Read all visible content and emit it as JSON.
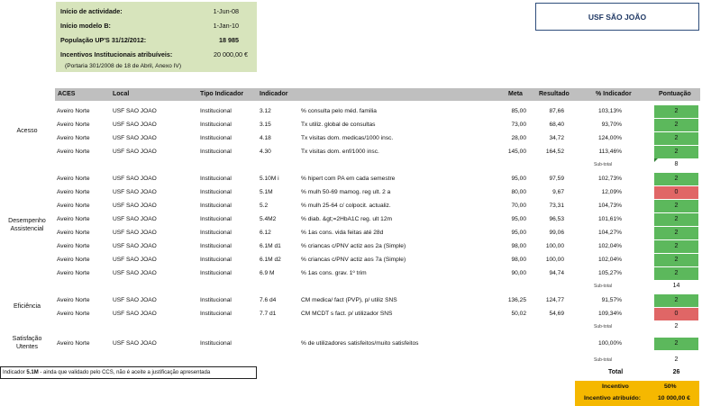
{
  "info": {
    "rows": [
      {
        "label": "Início de actividade:",
        "value": "1-Jun-08"
      },
      {
        "label": "Início modelo B:",
        "value": "1-Jan-10"
      },
      {
        "label": "População UP'S 31/12/2012:",
        "value": "18 985"
      },
      {
        "label": "Incentivos Institucionais atribuíveis:",
        "value": "20 000,00 €"
      }
    ],
    "note": "(Portaria 301/2008 de 18 de Abril, Anexo IV)"
  },
  "title": "USF SÃO JOÃO",
  "headers": {
    "aces": "ACES",
    "local": "Local",
    "tipo": "Tipo Indicador",
    "indicador": "Indicador",
    "meta": "Meta",
    "resultado": "Resultado",
    "pct": "% Indicador",
    "pontuacao": "Pontuação"
  },
  "groups": {
    "acesso": "Acesso",
    "desempenho": "Desempenho Assistencial",
    "eficiencia": "Eficiência",
    "satisfacao": "Satisfação Utentes"
  },
  "rows": [
    {
      "aces": "Aveiro Norte",
      "local": "USF SAO JOAO",
      "tipo": "Institucional",
      "code": "3.12",
      "desc": "% consulta pelo méd. familia",
      "meta": "85,00",
      "resultado": "87,66",
      "pct": "103,13%",
      "score": "2"
    },
    {
      "aces": "Aveiro Norte",
      "local": "USF SAO JOAO",
      "tipo": "Institucional",
      "code": "3.15",
      "desc": "Tx utiliz. global de consultas",
      "meta": "73,00",
      "resultado": "68,40",
      "pct": "93,70%",
      "score": "2"
    },
    {
      "aces": "Aveiro Norte",
      "local": "USF SAO JOAO",
      "tipo": "Institucional",
      "code": "4.18",
      "desc": "Tx visitas dom. medicas/1000 insc.",
      "meta": "28,00",
      "resultado": "34,72",
      "pct": "124,00%",
      "score": "2"
    },
    {
      "aces": "Aveiro Norte",
      "local": "USF SAO JOAO",
      "tipo": "Institucional",
      "code": "4.30",
      "desc": "Tx visitas dom. enf/1000 insc.",
      "meta": "145,00",
      "resultado": "164,52",
      "pct": "113,46%",
      "score": "2"
    },
    {
      "aces": "Aveiro Norte",
      "local": "USF SAO JOAO",
      "tipo": "Institucional",
      "code": "5.10M i",
      "desc": "% hipert com PA em cada semestre",
      "meta": "95,00",
      "resultado": "97,59",
      "pct": "102,73%",
      "score": "2"
    },
    {
      "aces": "Aveiro Norte",
      "local": "USF SAO JOAO",
      "tipo": "Institucional",
      "code": "5.1M",
      "desc": "% mulh 50-69 mamog. reg ult. 2 a",
      "meta": "80,00",
      "resultado": "9,67",
      "pct": "12,09%",
      "score": "0"
    },
    {
      "aces": "Aveiro Norte",
      "local": "USF SAO JOAO",
      "tipo": "Institucional",
      "code": "5.2",
      "desc": "% mulh 25-64 c/ colpocit. actualiz.",
      "meta": "70,00",
      "resultado": "73,31",
      "pct": "104,73%",
      "score": "2"
    },
    {
      "aces": "Aveiro Norte",
      "local": "USF SAO JOAO",
      "tipo": "Institucional",
      "code": "5.4M2",
      "desc": "% diab. &gt;=2HbA1C reg. ult 12m",
      "meta": "95,00",
      "resultado": "96,53",
      "pct": "101,61%",
      "score": "2"
    },
    {
      "aces": "Aveiro Norte",
      "local": "USF SAO JOAO",
      "tipo": "Institucional",
      "code": "6.12",
      "desc": "% 1as cons. vida feitas até 28d",
      "meta": "95,00",
      "resultado": "99,06",
      "pct": "104,27%",
      "score": "2"
    },
    {
      "aces": "Aveiro Norte",
      "local": "USF SAO JOAO",
      "tipo": "Institucional",
      "code": "6.1M d1",
      "desc": "% criancas c/PNV actiz aos 2a (Simple)",
      "meta": "98,00",
      "resultado": "100,00",
      "pct": "102,04%",
      "score": "2"
    },
    {
      "aces": "Aveiro Norte",
      "local": "USF SAO JOAO",
      "tipo": "Institucional",
      "code": "6.1M d2",
      "desc": "% criancas c/PNV actiz aos 7a (Simple)",
      "meta": "98,00",
      "resultado": "100,00",
      "pct": "102,04%",
      "score": "2"
    },
    {
      "aces": "Aveiro Norte",
      "local": "USF SAO JOAO",
      "tipo": "Institucional",
      "code": "6.9 M",
      "desc": "% 1as cons. grav. 1º trim",
      "meta": "90,00",
      "resultado": "94,74",
      "pct": "105,27%",
      "score": "2"
    },
    {
      "aces": "Aveiro Norte",
      "local": "USF SAO JOAO",
      "tipo": "Institucional",
      "code": "7.6 d4",
      "desc": "CM medica/ fact (PVP), p/ utiliz SNS",
      "meta": "136,25",
      "resultado": "124,77",
      "pct": "91,57%",
      "score": "2"
    },
    {
      "aces": "Aveiro Norte",
      "local": "USF SAO JOAO",
      "tipo": "Institucional",
      "code": "7.7 d1",
      "desc": "CM MCDT s fact. p/ utilizador SNS",
      "meta": "50,02",
      "resultado": "54,69",
      "pct": "109,34%",
      "score": "0"
    },
    {
      "aces": "Aveiro Norte",
      "local": "USF SAO JOAO",
      "tipo": "Institucional",
      "code": "",
      "desc": "% de utilizadores satisfeitos/muito satisfeitos",
      "meta": "",
      "resultado": "",
      "pct": "100,00%",
      "score": "2"
    }
  ],
  "subtotals": {
    "label": "Sub-total",
    "acesso": "8",
    "desempenho": "14",
    "eficiencia": "2",
    "satisfacao": "2"
  },
  "footnote": {
    "prefix": "Indicador ",
    "code": "5.1M",
    "text": " - ainda que validado pelo CCS, não é aceite a justificação apresentada"
  },
  "total": {
    "label": "Total",
    "value": "26"
  },
  "incentivo": {
    "label": "Incentivo",
    "value": "50%",
    "atribuido_label": "Incentivo atribuído:",
    "atribuido_value": "10 000,00 €"
  },
  "colors": {
    "green": "#5cb85c",
    "red": "#e06666",
    "info_bg": "#d7e4bc",
    "incentive_bg": "#f5b800",
    "header_bg": "#bfbfbf"
  }
}
